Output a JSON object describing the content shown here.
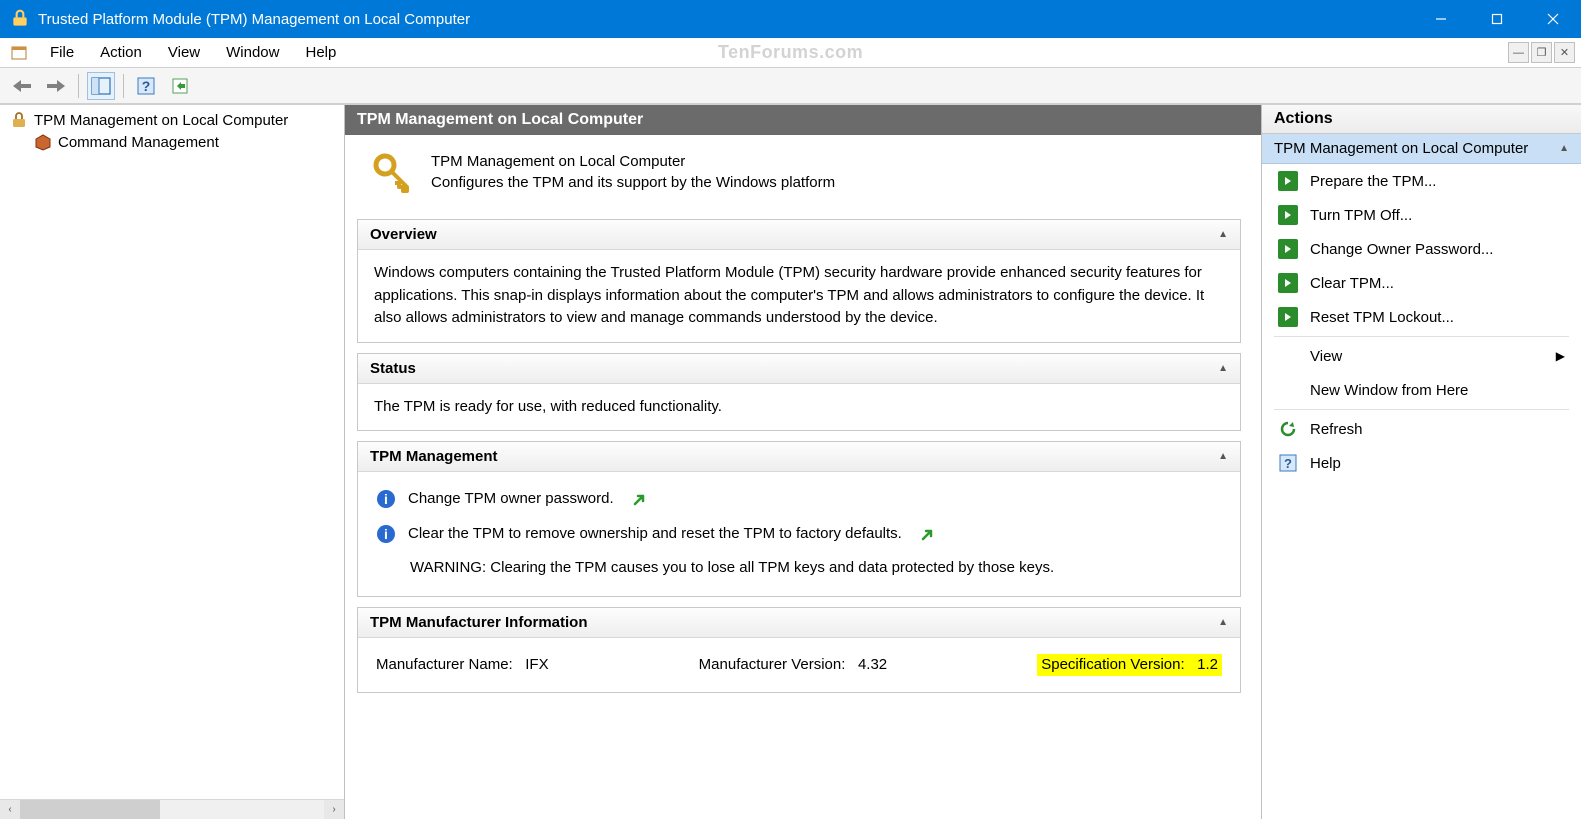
{
  "title_bar": {
    "title": "Trusted Platform Module (TPM) Management on Local Computer"
  },
  "menu": [
    "File",
    "Action",
    "View",
    "Window",
    "Help"
  ],
  "watermark": "TenForums.com",
  "tree": {
    "root": "TPM Management on Local Computer",
    "child": "Command Management"
  },
  "content": {
    "header": "TPM Management on Local Computer",
    "desc_title": "TPM Management on Local Computer",
    "desc_sub": "Configures the TPM and its support by the Windows platform",
    "overview": {
      "title": "Overview",
      "body": "Windows computers containing the Trusted Platform Module (TPM) security hardware provide enhanced security features for applications. This snap-in displays information about the computer's TPM and allows administrators to configure the device. It also allows administrators to view and manage commands understood by the device."
    },
    "status": {
      "title": "Status",
      "body": "The TPM is ready for use, with reduced functionality."
    },
    "mgmt": {
      "title": "TPM Management",
      "change_pw": "Change TPM owner password.",
      "clear": "Clear the TPM to remove ownership and reset the TPM to factory defaults.",
      "warning": "WARNING: Clearing the TPM causes you to lose all TPM keys and data protected by those keys."
    },
    "mfr": {
      "title": "TPM Manufacturer Information",
      "name_label": "Manufacturer Name:",
      "name_value": "IFX",
      "ver_label": "Manufacturer Version:",
      "ver_value": "4.32",
      "spec_label": "Specification Version:",
      "spec_value": "1.2"
    }
  },
  "actions": {
    "header": "Actions",
    "group": "TPM Management on Local Computer",
    "items": {
      "prepare": "Prepare the TPM...",
      "turn_off": "Turn TPM Off...",
      "change_pw": "Change Owner Password...",
      "clear": "Clear TPM...",
      "reset": "Reset TPM Lockout...",
      "view": "View",
      "new_window": "New Window from Here",
      "refresh": "Refresh",
      "help": "Help"
    }
  }
}
